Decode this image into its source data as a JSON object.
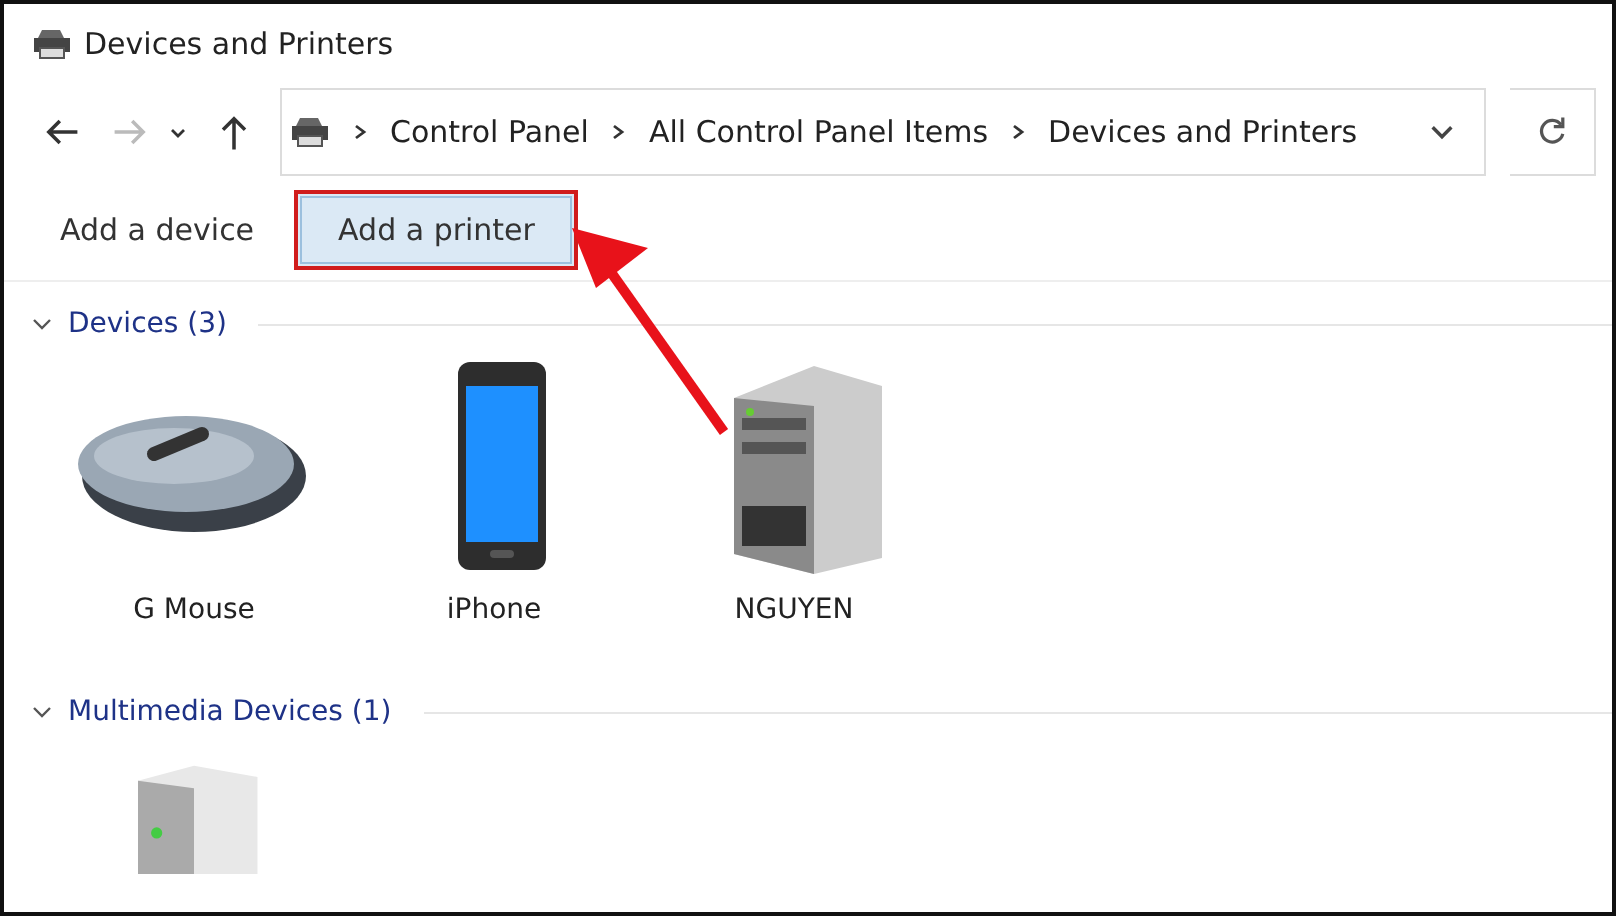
{
  "window": {
    "title": "Devices and Printers"
  },
  "address_bar": {
    "path": [
      "Control Panel",
      "All Control Panel Items",
      "Devices and Printers"
    ]
  },
  "toolbar": [
    {
      "label": "Add a device",
      "highlighted": false
    },
    {
      "label": "Add a printer",
      "highlighted": true
    }
  ],
  "groups": [
    {
      "title": "Devices (3)",
      "expanded": true,
      "items": [
        {
          "kind": "mouse",
          "label": "G Mouse"
        },
        {
          "kind": "phone",
          "label": "iPhone"
        },
        {
          "kind": "computer",
          "label": "NGUYEN"
        }
      ]
    },
    {
      "title": "Multimedia Devices (1)",
      "expanded": true,
      "items": [
        {
          "kind": "media"
        }
      ]
    }
  ]
}
